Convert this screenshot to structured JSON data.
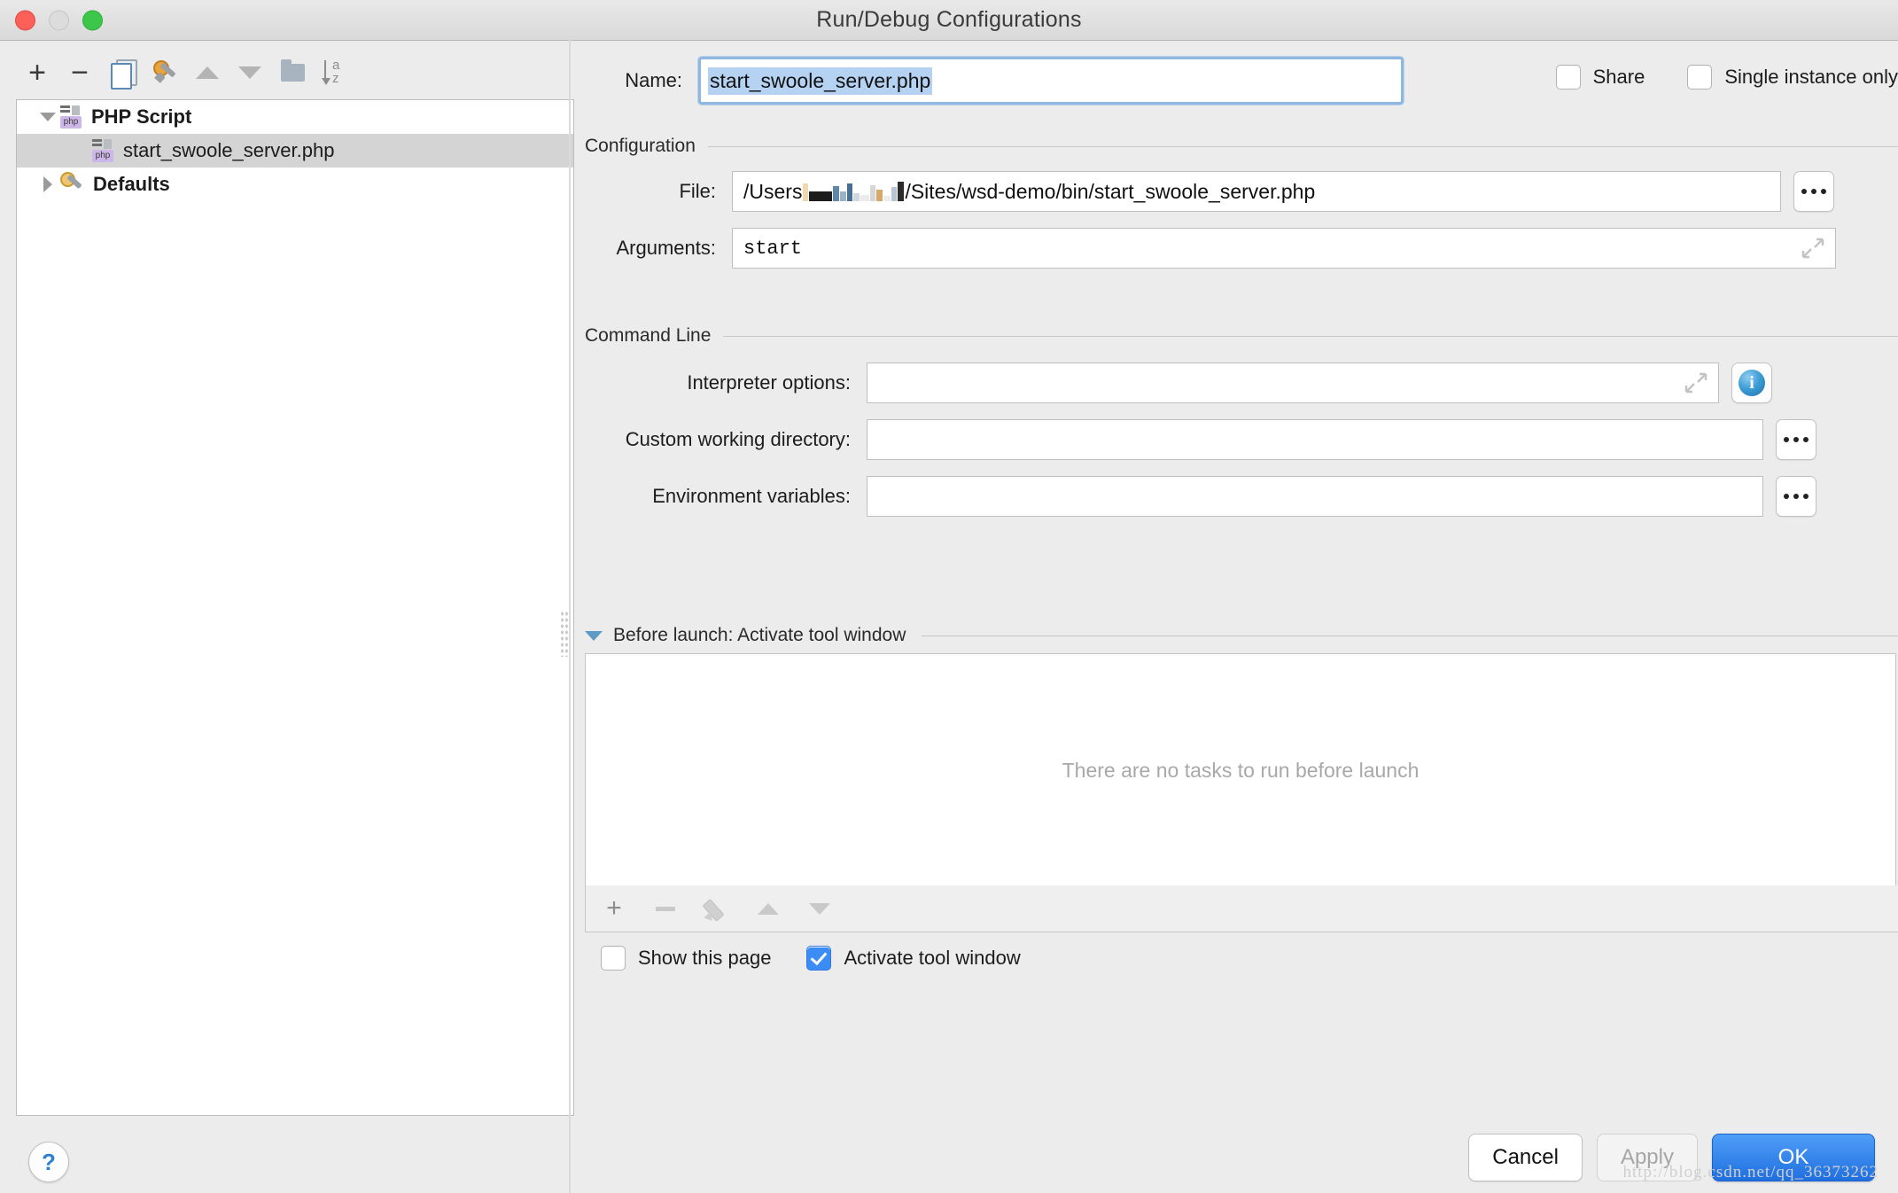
{
  "window": {
    "title": "Run/Debug Configurations",
    "controls": [
      "close",
      "minimize",
      "zoom"
    ]
  },
  "toolbar": {
    "items": [
      {
        "name": "add-button",
        "icon": "plus-icon",
        "label": "+"
      },
      {
        "name": "remove-button",
        "icon": "minus-icon",
        "label": "−"
      },
      {
        "name": "copy-configuration-button",
        "icon": "copy-icon",
        "label": ""
      },
      {
        "name": "edit-defaults-button",
        "icon": "wrench-icon",
        "label": ""
      },
      {
        "name": "move-up-button",
        "icon": "triangle-up-icon",
        "label": ""
      },
      {
        "name": "move-down-button",
        "icon": "triangle-down-icon",
        "label": ""
      },
      {
        "name": "move-into-folder-button",
        "icon": "folder-icon",
        "label": ""
      },
      {
        "name": "sort-alphabetically-button",
        "icon": "sort-az-icon",
        "label": ""
      }
    ],
    "sort_a": "a",
    "sort_z": "z"
  },
  "tree": {
    "nodes": [
      {
        "label": "PHP Script",
        "icon": "php-file-icon",
        "expanded": true,
        "bold": true,
        "selected": false,
        "depth": 0
      },
      {
        "label": "start_swoole_server.php",
        "icon": "php-file-icon",
        "expanded": null,
        "bold": false,
        "selected": true,
        "depth": 1
      },
      {
        "label": "Defaults",
        "icon": "defaults-gear-wrench-icon",
        "expanded": false,
        "bold": true,
        "selected": false,
        "depth": 0
      }
    ]
  },
  "name_row": {
    "label": "Name:",
    "value": "start_swoole_server.php",
    "selected": true
  },
  "options": {
    "share": {
      "label": "Share",
      "checked": false
    },
    "single_instance": {
      "label": "Single instance only",
      "checked": false
    }
  },
  "configuration": {
    "section_title": "Configuration",
    "file": {
      "label": "File:",
      "prefix": "/Users",
      "redacted": true,
      "suffix": "/Sites/wsd-demo/bin/start_swoole_server.php",
      "browse_label": "..."
    },
    "arguments": {
      "label": "Arguments:",
      "value": "start",
      "expand_icon": "expand-arrows-icon"
    }
  },
  "command_line": {
    "section_title": "Command Line",
    "fields": [
      {
        "label": "Interpreter options:",
        "value": "",
        "trailing": "info",
        "expand_icon": "expand-arrows-icon",
        "info_label": "i"
      },
      {
        "label": "Custom working directory:",
        "value": "",
        "trailing": "browse",
        "browse_label": "..."
      },
      {
        "label": "Environment variables:",
        "value": "",
        "trailing": "browse",
        "browse_label": "..."
      }
    ]
  },
  "before_launch": {
    "title": "Before launch: Activate tool window",
    "expanded": true,
    "empty_text": "There are no tasks to run before launch",
    "toolbar": [
      {
        "name": "add-task-button",
        "icon": "plus-icon",
        "label": "+"
      },
      {
        "name": "remove-task-button",
        "icon": "minus-icon",
        "label": ""
      },
      {
        "name": "edit-task-button",
        "icon": "pencil-icon",
        "label": ""
      },
      {
        "name": "move-task-up-button",
        "icon": "triangle-up-icon",
        "label": ""
      },
      {
        "name": "move-task-down-button",
        "icon": "triangle-down-icon",
        "label": ""
      }
    ],
    "show_this_page": {
      "label": "Show this page",
      "checked": false
    },
    "activate_tool_window": {
      "label": "Activate tool window",
      "checked": true
    }
  },
  "footer": {
    "help_label": "?",
    "cancel_label": "Cancel",
    "apply_label": "Apply",
    "apply_enabled": false,
    "ok_label": "OK"
  },
  "watermark": "http://blog.csdn.net/qq_36373262",
  "colors": {
    "accent_blue": "#3b8cf4",
    "ok_button": "#2f7ae0",
    "selection_blue": "#b5d2f2",
    "focus_ring": "#8fb7e2",
    "window_bg": "#ececec",
    "disabled_text": "#a6a6a6"
  }
}
